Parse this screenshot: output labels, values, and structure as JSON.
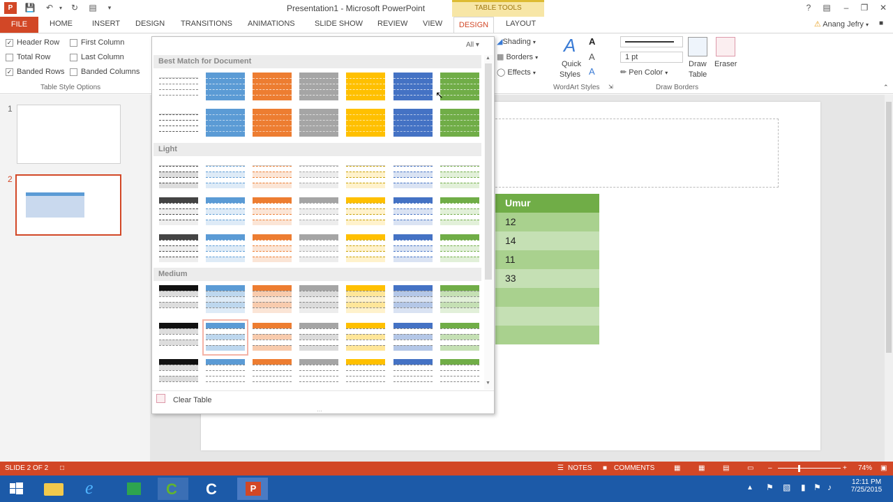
{
  "window": {
    "title": "Presentation1 - Microsoft PowerPoint",
    "context_tab_group": "TABLE TOOLS",
    "user": "Anang Jefry",
    "help": "?"
  },
  "tabs": [
    "FILE",
    "HOME",
    "INSERT",
    "DESIGN",
    "TRANSITIONS",
    "ANIMATIONS",
    "SLIDE SHOW",
    "REVIEW",
    "VIEW",
    "DESIGN",
    "LAYOUT"
  ],
  "ribbon": {
    "options": [
      {
        "label": "Header Row",
        "checked": true
      },
      {
        "label": "First Column",
        "checked": false
      },
      {
        "label": "Total Row",
        "checked": false
      },
      {
        "label": "Last Column",
        "checked": false
      },
      {
        "label": "Banded Rows",
        "checked": true
      },
      {
        "label": "Banded Columns",
        "checked": false
      }
    ],
    "options_group": "Table Style Options",
    "shading": "Shading",
    "borders": "Borders",
    "effects": "Effects",
    "quick_styles_1": "Quick",
    "quick_styles_2": "Styles",
    "wordart_group": "WordArt Styles",
    "pen_weight": "1 pt",
    "pen_color": "Pen Color",
    "draw_table_1": "Draw",
    "draw_table_2": "Table",
    "eraser": "Eraser",
    "draw_borders_group": "Draw Borders"
  },
  "gallery": {
    "filter": "All",
    "sections": [
      "Best Match for Document",
      "Light",
      "Medium"
    ],
    "clear_table": "Clear Table"
  },
  "slides": [
    "1",
    "2"
  ],
  "table": {
    "header": "Umur",
    "values": [
      "12",
      "14",
      "11",
      "33",
      "",
      "",
      ""
    ],
    "header_color": "#70ad47",
    "row_colors": [
      "#a9d18e",
      "#c5e0b4"
    ]
  },
  "status": {
    "slide": "SLIDE 2 OF 2",
    "notes": "NOTES",
    "comments": "COMMENTS",
    "zoom": "74%"
  },
  "taskbar": {
    "time": "12:11 PM",
    "date": "7/25/2015"
  },
  "colors": {
    "accent": "#d24726",
    "taskbar": "#1c5aa8"
  }
}
